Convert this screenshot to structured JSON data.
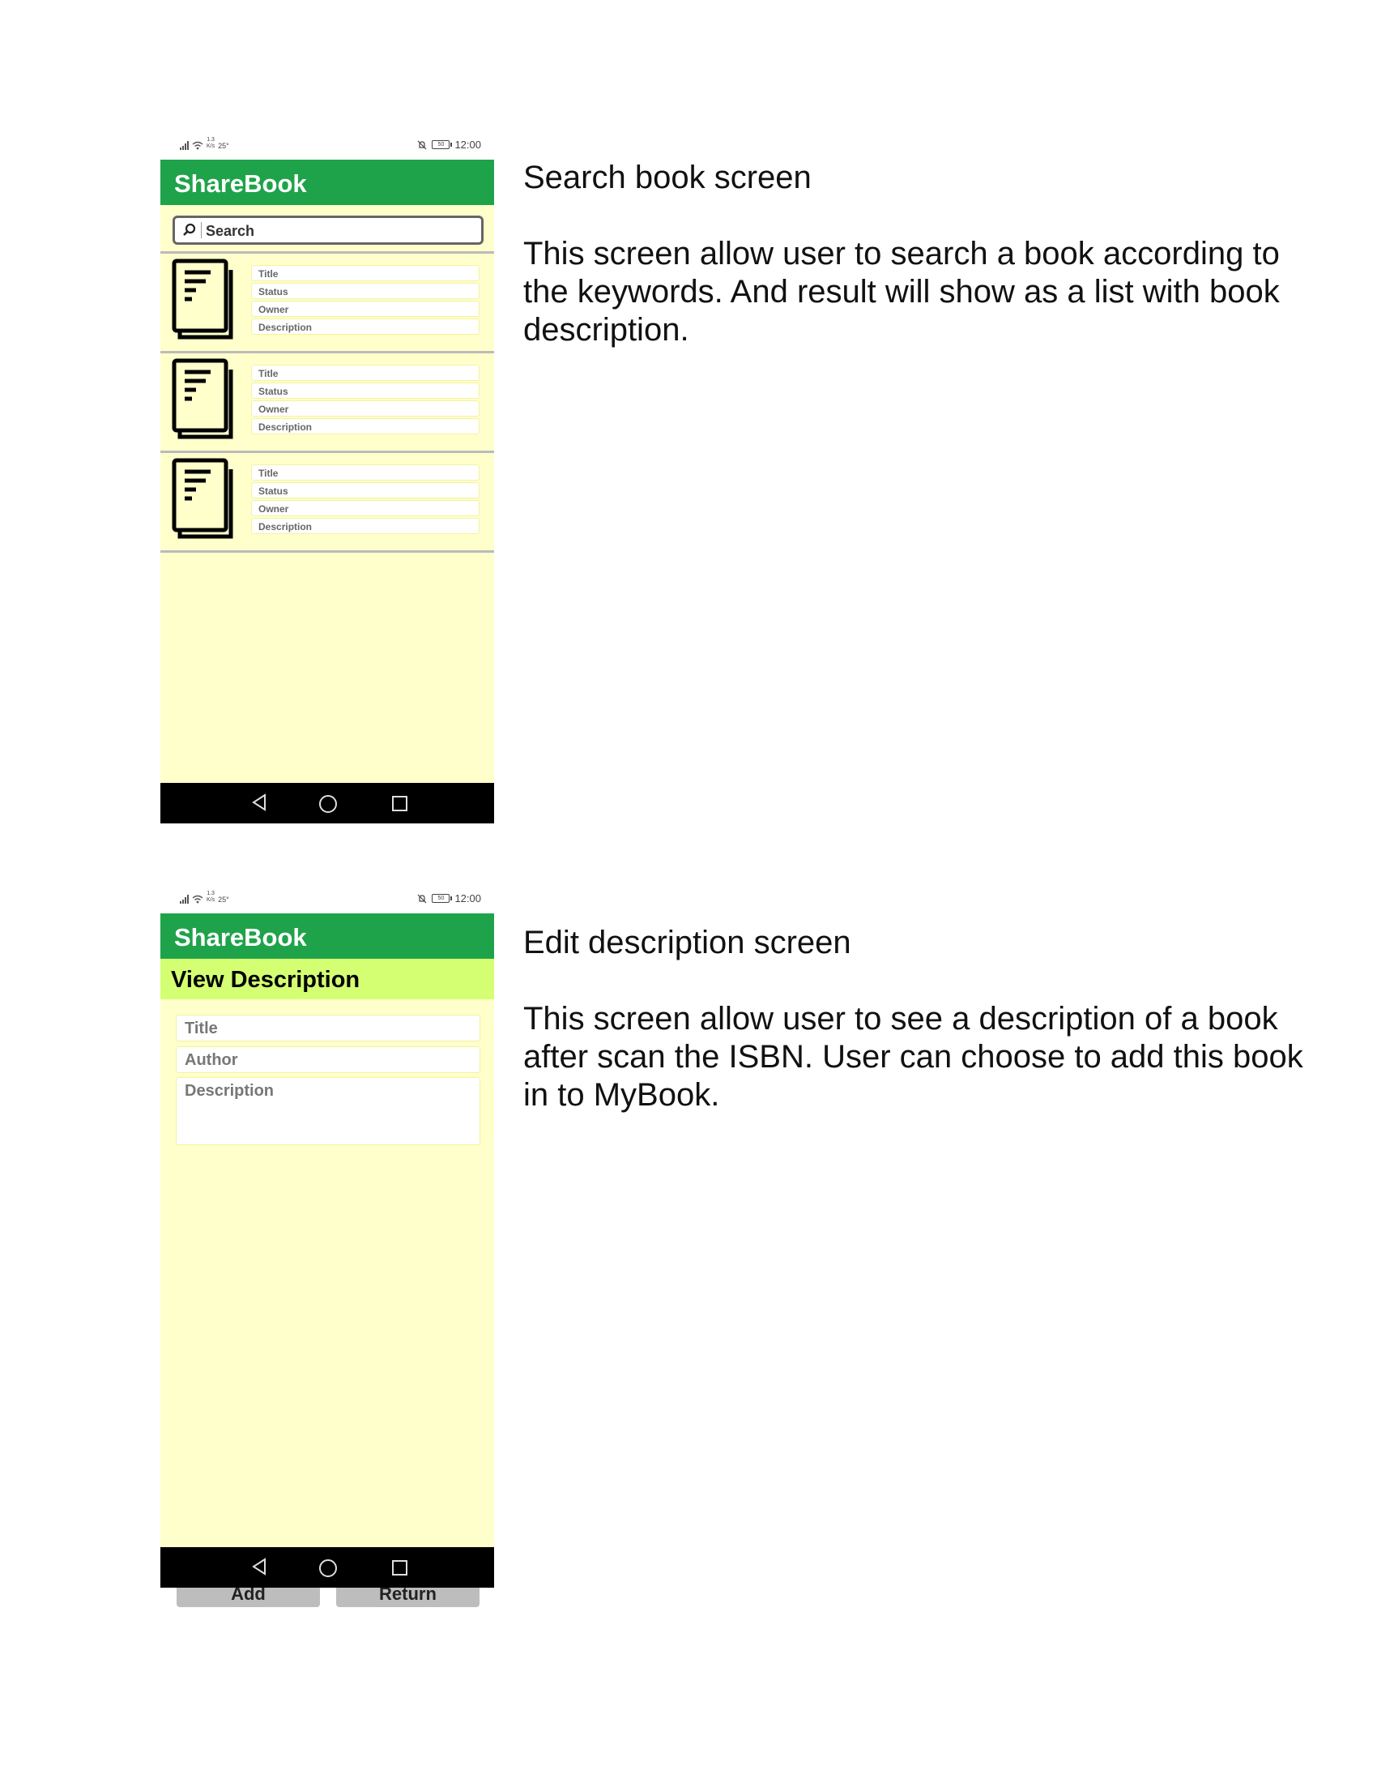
{
  "status_bar": {
    "speed_top": "1.3",
    "speed_bottom": "K/s",
    "temp": "25°",
    "battery": "50",
    "time": "12:00"
  },
  "search_screen": {
    "app_title": "ShareBook",
    "search_placeholder": "Search",
    "results": [
      {
        "title": "Title",
        "status": "Status",
        "owner": "Owner",
        "description": "Description"
      },
      {
        "title": "Title",
        "status": "Status",
        "owner": "Owner",
        "description": "Description"
      },
      {
        "title": "Title",
        "status": "Status",
        "owner": "Owner",
        "description": "Description"
      }
    ],
    "caption_heading": "Search book screen",
    "caption_body": "This screen allow user to search a book according to the keywords. And result will show as a list with book description."
  },
  "description_screen": {
    "app_title": "ShareBook",
    "section_title": "View Description",
    "fields": {
      "title": "Title",
      "author": "Author",
      "description": "Description"
    },
    "buttons": {
      "add": "Add",
      "return": "Return"
    },
    "caption_heading": "Edit description screen",
    "caption_body": "This screen allow user to see a description of a book after scan the ISBN. User can choose to add this book in to MyBook."
  }
}
